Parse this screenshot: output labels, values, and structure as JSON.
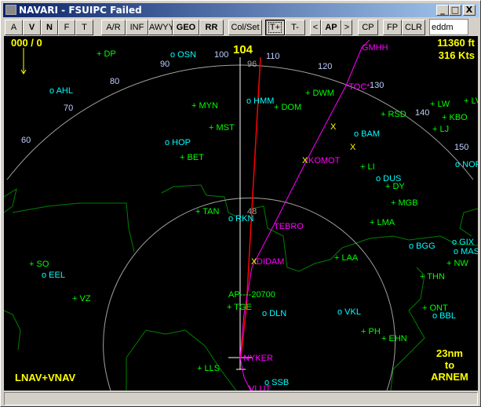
{
  "window": {
    "title": "NAVARI - FSUIPC Failed",
    "min": "_",
    "max": "□",
    "close": "X"
  },
  "toolbar": {
    "buttons": [
      "A",
      "V",
      "N",
      "F",
      "T",
      "A/R",
      "INF",
      "AWYY",
      "GEO",
      "RR",
      "Col/Set",
      "T+",
      "T-",
      "<",
      "AP",
      ">",
      "CP",
      "FP",
      "CLR"
    ],
    "airport_input": "eddm"
  },
  "overlay": {
    "wind": "000 / 0",
    "heading": "104",
    "altitude": "11360 ft",
    "speed": "316 Kts",
    "mode": "LNAV+VNAV",
    "dist": "23nm",
    "to": "to",
    "dest": "ARNEM",
    "ap_alt": "AP----20700"
  },
  "compass": {
    "ticks": [
      "60",
      "70",
      "80",
      "90",
      "100",
      "110",
      "120",
      "130",
      "140",
      "150"
    ],
    "outer_range": "96",
    "inner_range": "48"
  },
  "vor": [
    "OSN",
    "AHL",
    "HMM",
    "HOP",
    "BAM",
    "DUS",
    "NOR",
    "BGG",
    "GIX",
    "MAS",
    "BBL",
    "DLN",
    "VKL",
    "SSB",
    "EEL",
    "RKN"
  ],
  "ndb": [
    "DP",
    "MYN",
    "MST",
    "BET",
    "DWM",
    "DOM",
    "RSD",
    "LW",
    "LV",
    "KBO",
    "LJ",
    "LI",
    "DY",
    "MGB",
    "LMA",
    "LAA",
    "NW",
    "THN",
    "ONT",
    "PH",
    "EHN",
    "TGE",
    "LLS",
    "SO",
    "VZ",
    "TAN"
  ],
  "route": [
    "GMHH",
    "*TOC*",
    "KOMOT",
    "TEBRO",
    "DIDAM",
    "NYKER",
    "VLUT"
  ],
  "colors": {
    "ndb": "#00ff00",
    "vor": "#00ffff",
    "route": "#ff00ff",
    "info": "#ffff00"
  }
}
